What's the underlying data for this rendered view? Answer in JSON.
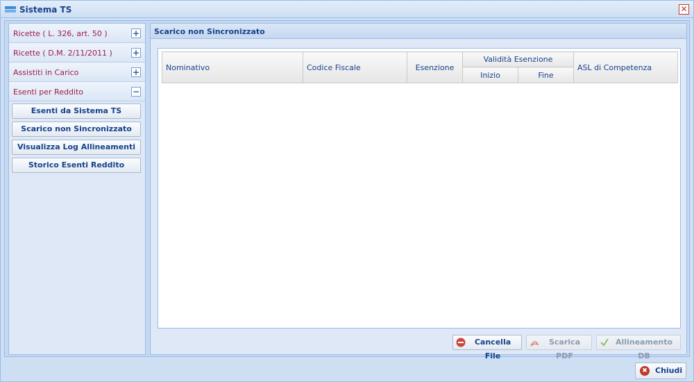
{
  "window": {
    "title": "Sistema TS",
    "close_glyph": "✕"
  },
  "sidebar": {
    "sections": [
      {
        "label": "Ricette ( L. 326, art. 50 )",
        "toggle": "+"
      },
      {
        "label": "Ricette ( D.M. 2/11/2011 )",
        "toggle": "+"
      },
      {
        "label": "Assistiti in Carico",
        "toggle": "+"
      },
      {
        "label": "Esenti per Reddito",
        "toggle": "−"
      }
    ],
    "buttons": [
      "Esenti da Sistema TS",
      "Scarico non Sincronizzato",
      "Visualizza Log Allineamenti",
      "Storico Esenti Reddito"
    ]
  },
  "main": {
    "title": "Scarico non Sincronizzato",
    "columns": {
      "nominativo": "Nominativo",
      "codice_fiscale": "Codice Fiscale",
      "esenzione": "Esenzione",
      "validita": "Validità Esenzione",
      "inizio": "Inizio",
      "fine": "Fine",
      "asl": "ASL di Competenza"
    },
    "rows": [],
    "buttons": {
      "cancella": "Cancella File",
      "scarica": "Scarica PDF",
      "allineamento": "Allineamento DB"
    }
  },
  "footer": {
    "close_label": "Chiudi"
  },
  "colors": {
    "accent": "#15428b",
    "section_text": "#9c1a4a",
    "danger": "#c0392b"
  },
  "icons": {
    "window": "window-icon",
    "cancella": "minus-circle-icon",
    "scarica": "pdf-icon",
    "allineamento": "check-icon",
    "close": "close-circle-icon"
  }
}
